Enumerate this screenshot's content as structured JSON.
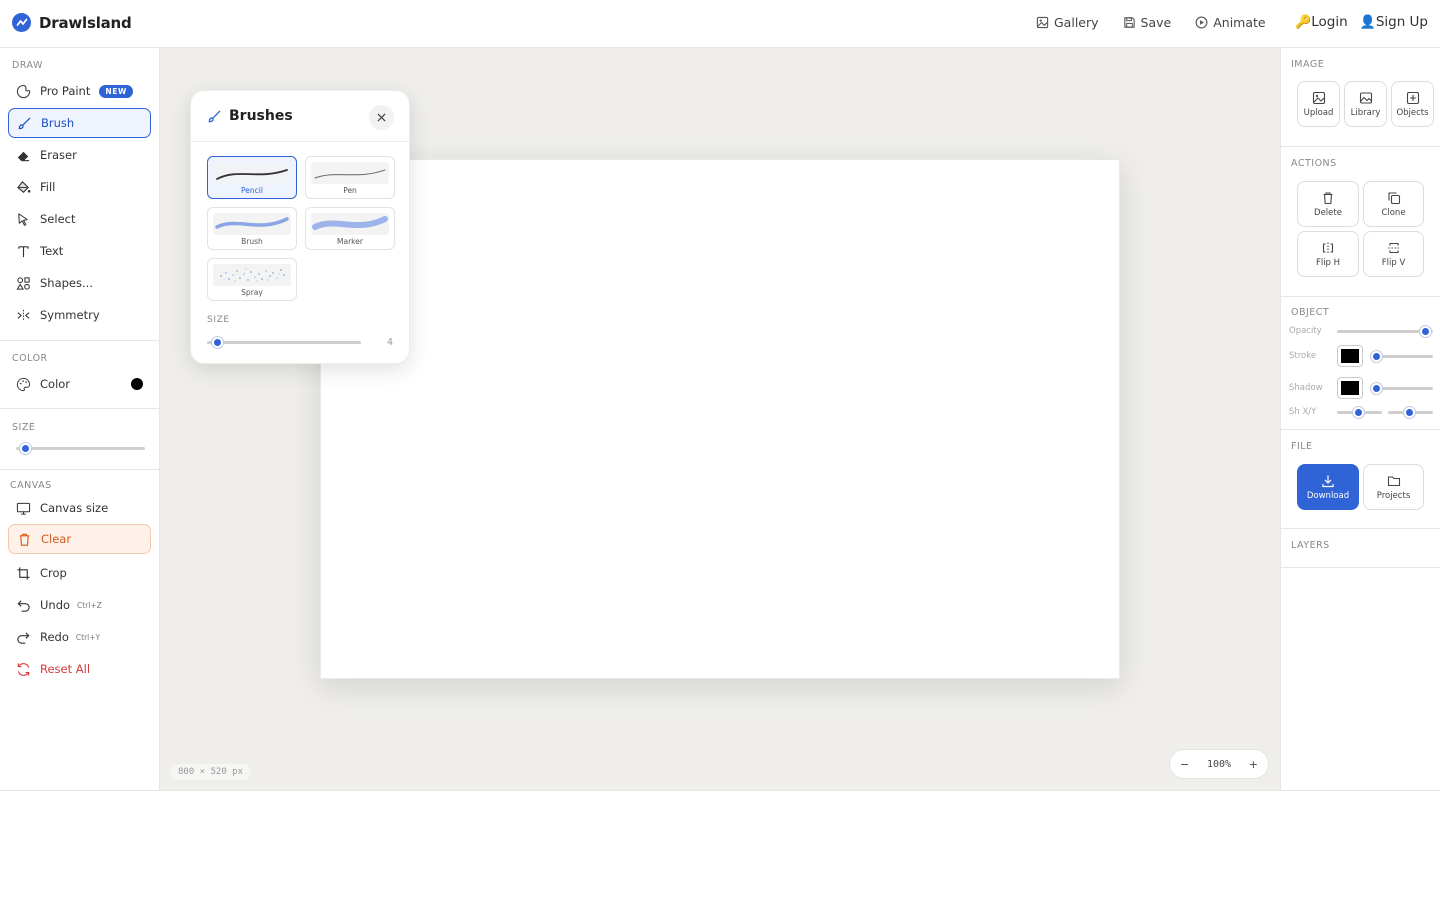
{
  "header": {
    "brand": "Drawlsland",
    "nav": [
      {
        "label": "Gallery",
        "icon": "image-icon"
      },
      {
        "label": "Save",
        "icon": "save-icon"
      },
      {
        "label": "Animate",
        "icon": "play-icon"
      }
    ],
    "login": "Login",
    "signup": "Sign Up"
  },
  "left": {
    "draw_title": "DRAW",
    "tools": [
      {
        "label": "Pro Paint",
        "badge": "NEW"
      },
      {
        "label": "Brush"
      },
      {
        "label": "Eraser"
      },
      {
        "label": "Fill"
      },
      {
        "label": "Select"
      },
      {
        "label": "Text"
      },
      {
        "label": "Shapes..."
      },
      {
        "label": "Symmetry"
      }
    ],
    "color_title": "COLOR",
    "color_label": "Color",
    "color_value": "#000000",
    "size_title": "SIZE",
    "size_value": 0.08,
    "canvas_title": "CANVAS",
    "canvas_tools": [
      {
        "label": "Canvas size"
      },
      {
        "label": "Clear"
      },
      {
        "label": "Crop"
      },
      {
        "label": "Undo",
        "shortcut": "Ctrl+Z"
      },
      {
        "label": "Redo",
        "shortcut": "Ctrl+Y"
      },
      {
        "label": "Reset All"
      }
    ]
  },
  "workspace": {
    "dimensions": "800 × 520 px",
    "zoom_minus": "−",
    "zoom_value": "100%",
    "zoom_plus": "+"
  },
  "brushes": {
    "title": "Brushes",
    "items": [
      "Pencil",
      "Pen",
      "Brush",
      "Marker",
      "Spray"
    ],
    "selected": "Pencil",
    "size_title": "SIZE",
    "size_value": "4"
  },
  "right": {
    "image_title": "IMAGE",
    "image_buttons": [
      "Upload",
      "Library",
      "Objects"
    ],
    "actions_title": "ACTIONS",
    "action_buttons": [
      "Delete",
      "Clone",
      "Flip H",
      "Flip V"
    ],
    "object_title": "OBJECT",
    "opacity_label": "Opacity",
    "stroke_label": "Stroke",
    "shadow_label": "Shadow",
    "shxy_label": "Sh X/Y",
    "file_title": "FILE",
    "file_buttons": [
      "Download",
      "Projects"
    ],
    "layers_title": "LAYERS"
  },
  "colors": {
    "accent": "#2f63d6",
    "danger": "#d63c3c",
    "clear": "#d45a1a",
    "workspace_bg": "#efeeea"
  }
}
